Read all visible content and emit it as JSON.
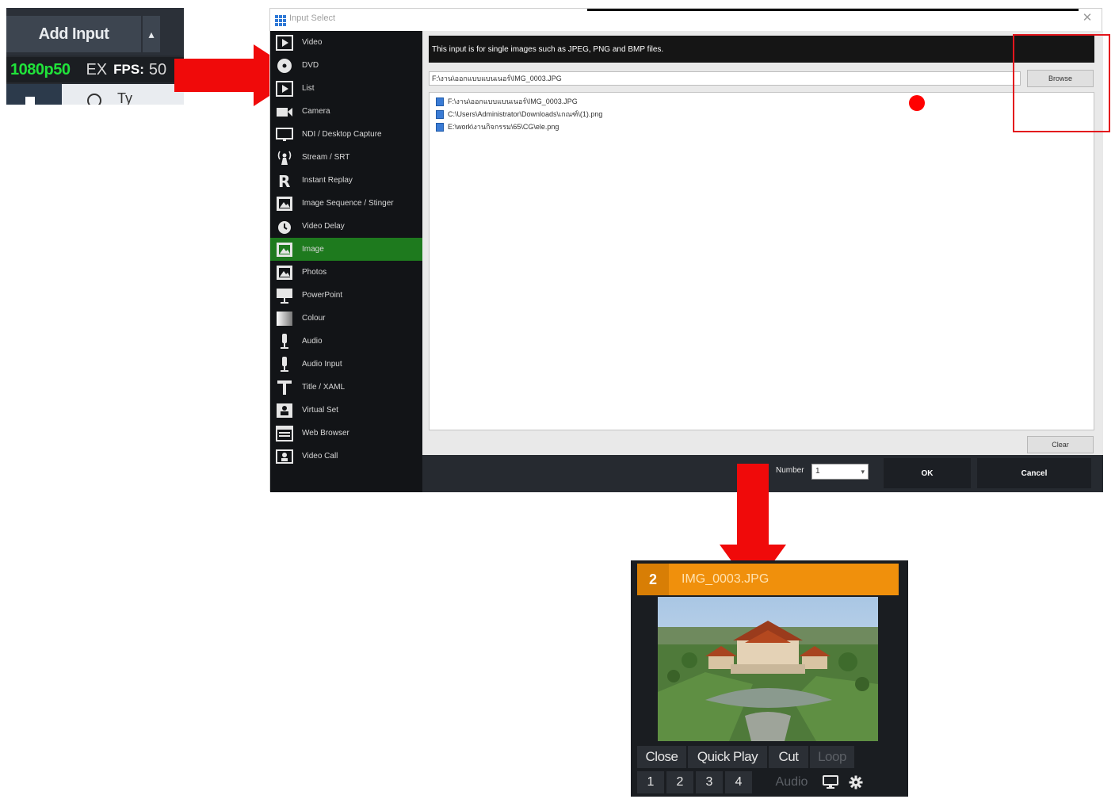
{
  "snippet": {
    "add_input_label": "Add Input",
    "dropdown_glyph": "▴",
    "resolution": "1080p50",
    "ex_label": "EX",
    "fps_label": "FPS:",
    "fps_value": "50",
    "taskbar_search": "Ty"
  },
  "dialog": {
    "title": "Input Select",
    "close_glyph": "✕",
    "description": "This input is for single images such as JPEG, PNG and BMP files.",
    "path_value": "F:\\งาน\\ออกแบบแบนเนอร์\\IMG_0003.JPG",
    "browse_label": "Browse",
    "clear_label": "Clear",
    "files": [
      "F:\\งาน\\ออกแบบแบนเนอร์\\IMG_0003.JPG",
      "C:\\Users\\Administrator\\Downloads\\เกณฑ์\\(1).png",
      "E:\\work\\งานกิจกรรม\\65\\CG\\ele.png"
    ],
    "number_label": "Number",
    "number_value": "1",
    "ok_label": "OK",
    "cancel_label": "Cancel",
    "selected_index": 9,
    "sidebar_items": [
      {
        "label": "Video",
        "icon": "video-icon"
      },
      {
        "label": "DVD",
        "icon": "dvd-icon"
      },
      {
        "label": "List",
        "icon": "list-icon"
      },
      {
        "label": "Camera",
        "icon": "camera-icon"
      },
      {
        "label": "NDI / Desktop Capture",
        "icon": "monitor-icon"
      },
      {
        "label": "Stream / SRT",
        "icon": "antenna-icon"
      },
      {
        "label": "Instant Replay",
        "icon": "replay-icon"
      },
      {
        "label": "Image Sequence / Stinger",
        "icon": "image-sequence-icon"
      },
      {
        "label": "Video Delay",
        "icon": "clock-icon"
      },
      {
        "label": "Image",
        "icon": "image-icon"
      },
      {
        "label": "Photos",
        "icon": "photos-icon"
      },
      {
        "label": "PowerPoint",
        "icon": "presentation-icon"
      },
      {
        "label": "Colour",
        "icon": "colour-icon"
      },
      {
        "label": "Audio",
        "icon": "microphone-icon"
      },
      {
        "label": "Audio Input",
        "icon": "microphone-icon"
      },
      {
        "label": "Title / XAML",
        "icon": "title-icon"
      },
      {
        "label": "Virtual Set",
        "icon": "virtual-set-icon"
      },
      {
        "label": "Web Browser",
        "icon": "browser-icon"
      },
      {
        "label": "Video Call",
        "icon": "video-call-icon"
      }
    ]
  },
  "card": {
    "number": "2",
    "name": "IMG_0003.JPG",
    "btn_close": "Close",
    "btn_quickplay": "Quick Play",
    "btn_cut": "Cut",
    "btn_loop": "Loop",
    "nums": [
      "1",
      "2",
      "3",
      "4"
    ],
    "audio_label": "Audio"
  },
  "colors": {
    "accent_green": "#1e7a1e",
    "resolution_green": "#20e33a",
    "card_orange": "#f0900c",
    "annotation_red": "#e3161d"
  }
}
